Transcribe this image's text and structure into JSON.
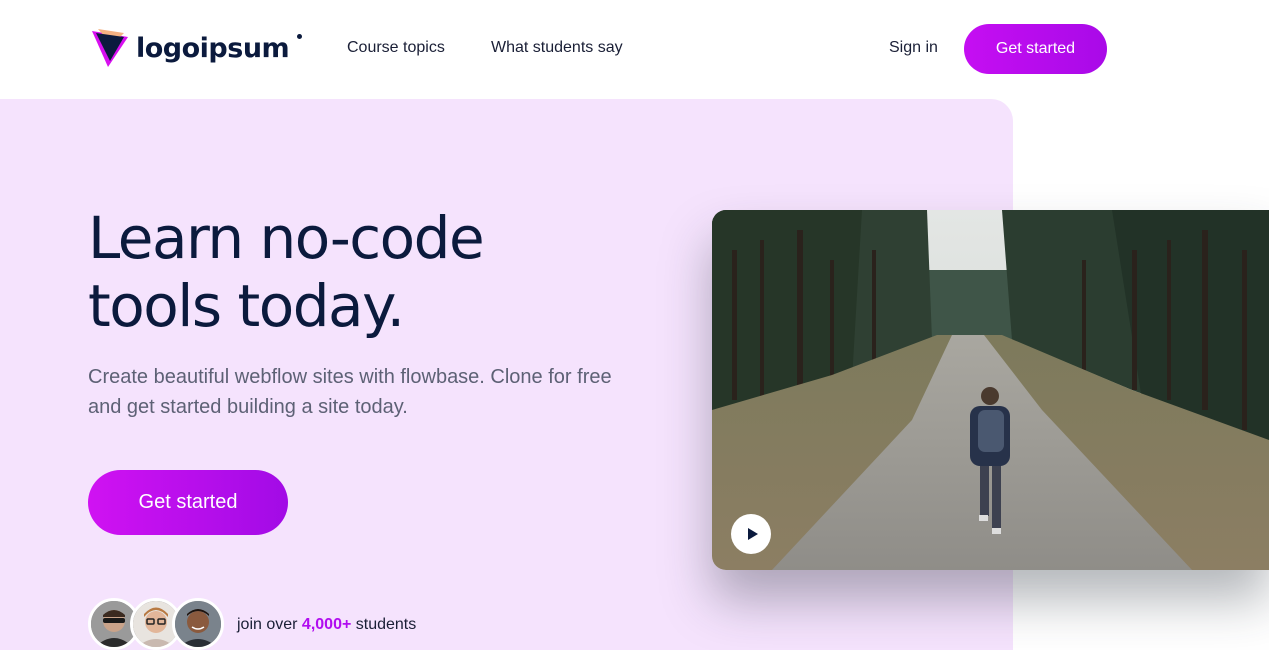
{
  "nav": {
    "logo_text": "logoipsum",
    "links": [
      "Course topics",
      "What students say"
    ],
    "signin_label": "Sign in",
    "cta_label": "Get started"
  },
  "hero": {
    "title_line1": "Learn no-code",
    "title_line2": "tools today.",
    "subtitle": "Create beautiful webflow sites with flowbase. Clone for free and get started building a site today.",
    "cta_label": "Get started",
    "social_proof": {
      "prefix": "join over ",
      "count": "4,000+",
      "suffix": " students"
    }
  },
  "video": {
    "play_icon": "play-icon"
  },
  "colors": {
    "accent": "#b10cf0",
    "hero_bg": "#f5e3fd",
    "heading": "#0b1a3d"
  }
}
